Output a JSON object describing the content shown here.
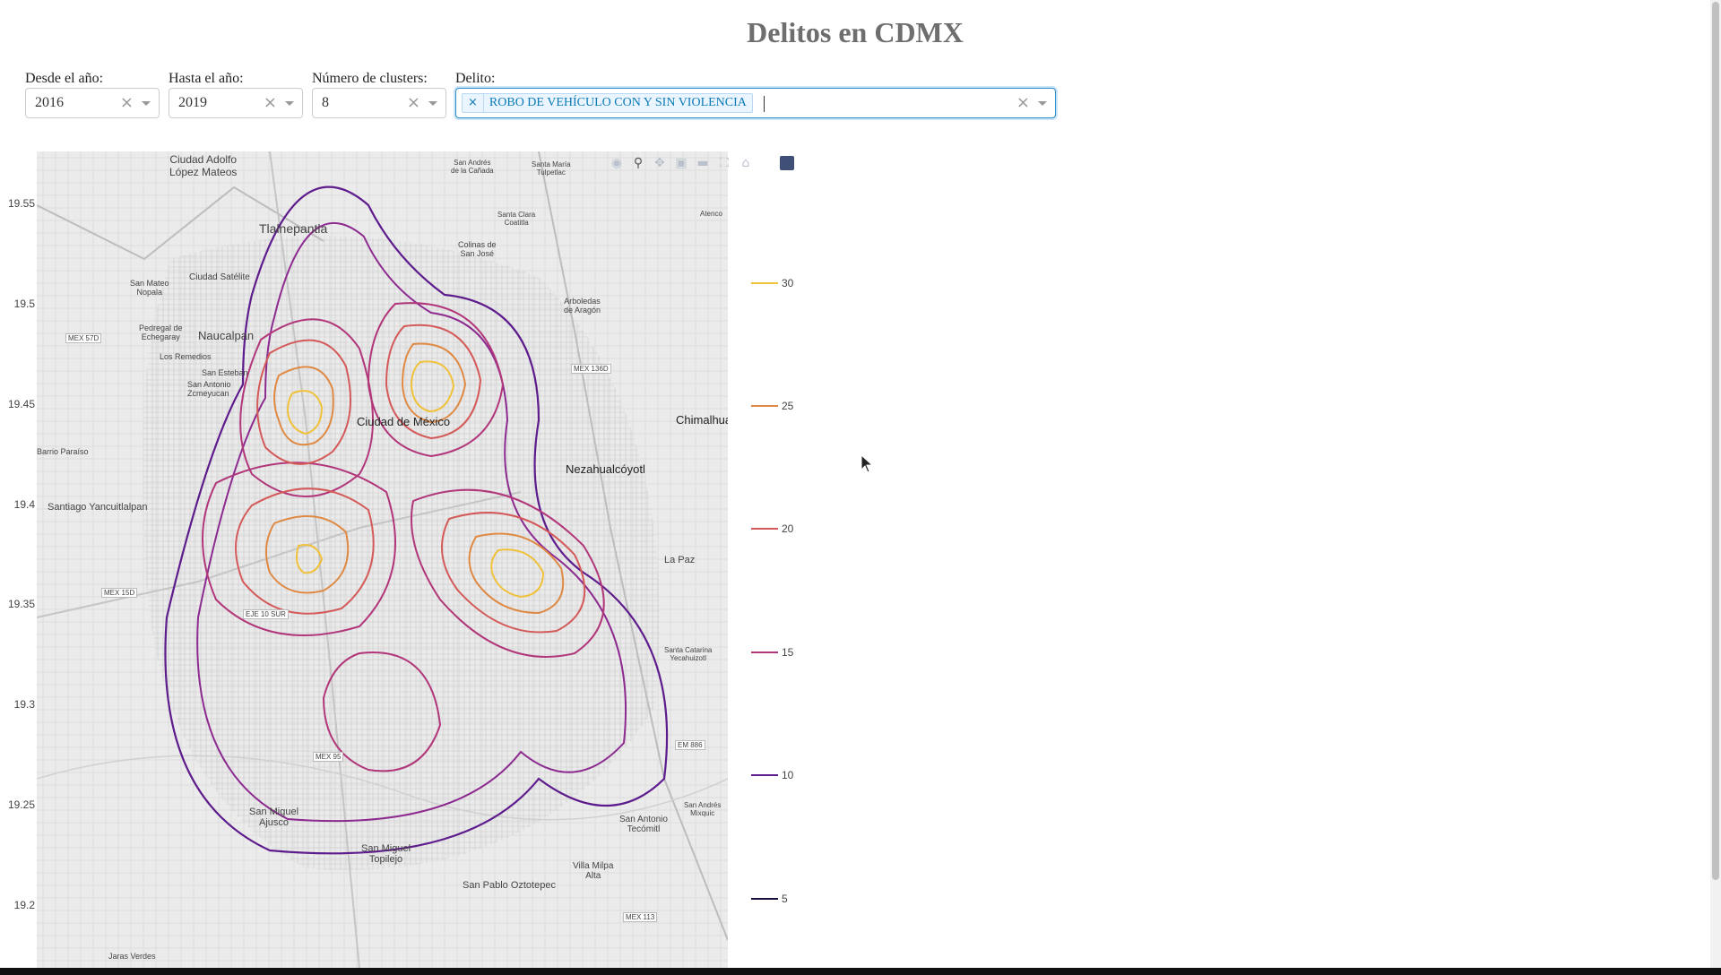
{
  "page": {
    "title": "Delitos en CDMX"
  },
  "filters": {
    "from_year": {
      "label": "Desde el año:",
      "value": "2016",
      "clear": "×"
    },
    "to_year": {
      "label": "Hasta el año:",
      "value": "2019",
      "clear": "×"
    },
    "clusters": {
      "label": "Número de clusters:",
      "value": "8",
      "clear": "×"
    },
    "crime": {
      "label": "Delito:",
      "chip_remove": "×",
      "selected": "ROBO DE VEHÍCULO CON Y SIN VIOLENCIA",
      "clear": "×"
    }
  },
  "map": {
    "y_ticks": [
      "19.55",
      "19.5",
      "19.45",
      "19.4",
      "19.35",
      "19.3",
      "19.25",
      "19.2"
    ],
    "place_labels": {
      "ciudad_adolfo": "Ciudad Adolfo\nLópez Mateos",
      "tlalnepantla": "Tlalnepantla",
      "naucalpan": "Naucalpan",
      "ciudad_satelite": "Ciudad Satélite",
      "san_mateo": "San Mateo\nNopala",
      "pedregal": "Pedregal de\nEchegaray",
      "los_remedios": "Los Remedios",
      "san_esteban": "San Esteban",
      "san_antonio_z": "San Antonio\nZcmeyucan",
      "ciudad_mexico": "Ciudad de México",
      "nezahualcoyotl": "Nezahualcóyotl",
      "chimalhuacan": "Chimalhua",
      "la_paz": "La Paz",
      "santiago": "Santiago Yancuitlalpan",
      "barrio_paraiso": "Barrio Paraíso",
      "san_andres_canada": "San Andrés\nde la Cañada",
      "santa_maria": "Santa María\nTulpetlac",
      "santa_clara": "Santa Clara\nCoatitla",
      "colinas": "Colinas de\nSan José",
      "arboledas": "Arboledas\nde Aragón",
      "santa_catarina": "Santa Catarina\nYecahuizotl",
      "san_miguel_ajusco": "San Miguel\nAjusco",
      "san_miguel_topilejo": "San Miguel\nTopilejo",
      "san_pablo": "San Pablo Oztotepec",
      "villa_milpa": "Villa Milpa\nAlta",
      "san_antonio_tecomitl": "San Antonio\nTecómitl",
      "san_andres_mixquic": "San Andrés\nMixquic",
      "jaras_verdes": "Jaras Verdes",
      "mex57d": "MEX 57D",
      "mex136d": "MEX 136D",
      "mex15d": "MEX 15D",
      "eje10": "EJE 10 SUR",
      "mex95": "MEX 95",
      "em886": "EM 886",
      "mex113": "MEX 113",
      "atenco": "Atenco"
    }
  },
  "legend": {
    "items": [
      {
        "label": "30",
        "color": "#f0c13a"
      },
      {
        "label": "25",
        "color": "#df8a44"
      },
      {
        "label": "20",
        "color": "#d45a5a"
      },
      {
        "label": "15",
        "color": "#b1367a"
      },
      {
        "label": "10",
        "color": "#5d1b8c"
      },
      {
        "label": "5",
        "color": "#1c0d3f"
      }
    ]
  },
  "modebar": [
    "camera-icon",
    "zoom-icon",
    "pan-icon",
    "zoom-in-icon",
    "zoom-out-icon",
    "autoscale-icon",
    "reset-icon",
    "home-icon"
  ],
  "colors": {
    "accent": "#2f8ec3",
    "chip_bg": "#ebf5ff",
    "chip_text": "#0a7ab8"
  }
}
